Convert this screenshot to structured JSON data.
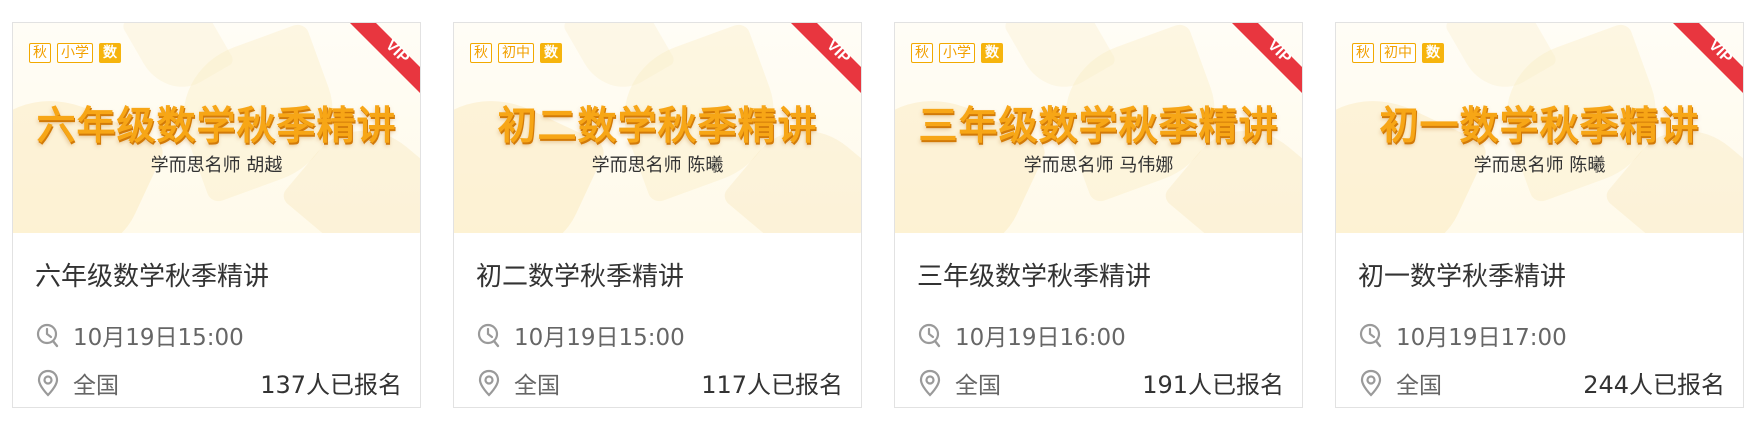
{
  "accent_color": "#f6b40d",
  "vip_color": "#e8363f",
  "cards": [
    {
      "tags": [
        "秋",
        "小学",
        "数"
      ],
      "vip_label": "VIP",
      "banner_title": "六年级数学秋季精讲",
      "banner_teacher": "学而思名师 胡越",
      "course_title": "六年级数学秋季精讲",
      "time": "10月19日15:00",
      "location": "全国",
      "enrolled": "137人已报名"
    },
    {
      "tags": [
        "秋",
        "初中",
        "数"
      ],
      "vip_label": "VIP",
      "banner_title": "初二数学秋季精讲",
      "banner_teacher": "学而思名师 陈曦",
      "course_title": "初二数学秋季精讲",
      "time": "10月19日15:00",
      "location": "全国",
      "enrolled": "117人已报名"
    },
    {
      "tags": [
        "秋",
        "小学",
        "数"
      ],
      "vip_label": "VIP",
      "banner_title": "三年级数学秋季精讲",
      "banner_teacher": "学而思名师 马伟娜",
      "course_title": "三年级数学秋季精讲",
      "time": "10月19日16:00",
      "location": "全国",
      "enrolled": "191人已报名"
    },
    {
      "tags": [
        "秋",
        "初中",
        "数"
      ],
      "vip_label": "VIP",
      "banner_title": "初一数学秋季精讲",
      "banner_teacher": "学而思名师 陈曦",
      "course_title": "初一数学秋季精讲",
      "time": "10月19日17:00",
      "location": "全国",
      "enrolled": "244人已报名"
    }
  ]
}
